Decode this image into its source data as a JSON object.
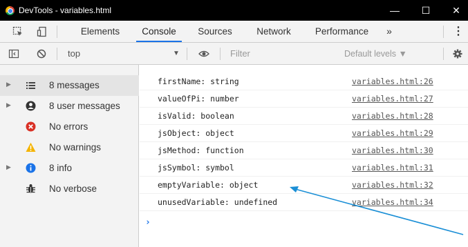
{
  "window": {
    "title": "DevTools - variables.html",
    "minimize": "—",
    "maximize": "☐",
    "close": "✕"
  },
  "tabs": {
    "items": [
      "Elements",
      "Console",
      "Sources",
      "Network",
      "Performance"
    ],
    "active": "Console",
    "more": "»",
    "menu": "⋮"
  },
  "toolbar": {
    "context": "top",
    "context_arrow": "▼",
    "filter_placeholder": "Filter",
    "levels": "Default levels ▼"
  },
  "sidebar": {
    "items": [
      {
        "label": "8 messages",
        "icon": "list-icon",
        "expandable": true,
        "selected": true
      },
      {
        "label": "8 user messages",
        "icon": "user-icon",
        "expandable": true
      },
      {
        "label": "No errors",
        "icon": "error-icon",
        "expandable": false
      },
      {
        "label": "No warnings",
        "icon": "warning-icon",
        "expandable": false
      },
      {
        "label": "8 info",
        "icon": "info-icon",
        "expandable": true
      },
      {
        "label": "No verbose",
        "icon": "bug-icon",
        "expandable": false
      }
    ]
  },
  "console": {
    "rows": [
      {
        "message": "firstName: string",
        "source": "variables.html:26"
      },
      {
        "message": "valueOfPi: number",
        "source": "variables.html:27"
      },
      {
        "message": "isValid: boolean",
        "source": "variables.html:28"
      },
      {
        "message": "jsObject: object",
        "source": "variables.html:29"
      },
      {
        "message": "jsMethod: function",
        "source": "variables.html:30"
      },
      {
        "message": "jsSymbol: symbol",
        "source": "variables.html:31"
      },
      {
        "message": "emptyVariable: object",
        "source": "variables.html:32"
      },
      {
        "message": "unusedVariable: undefined",
        "source": "variables.html:34"
      }
    ],
    "prompt": "›"
  },
  "colors": {
    "accent": "#1a73e8",
    "annotation_arrow": "#1b8fd6",
    "error": "#d93025",
    "warning": "#f4b400",
    "info": "#1a73e8"
  }
}
